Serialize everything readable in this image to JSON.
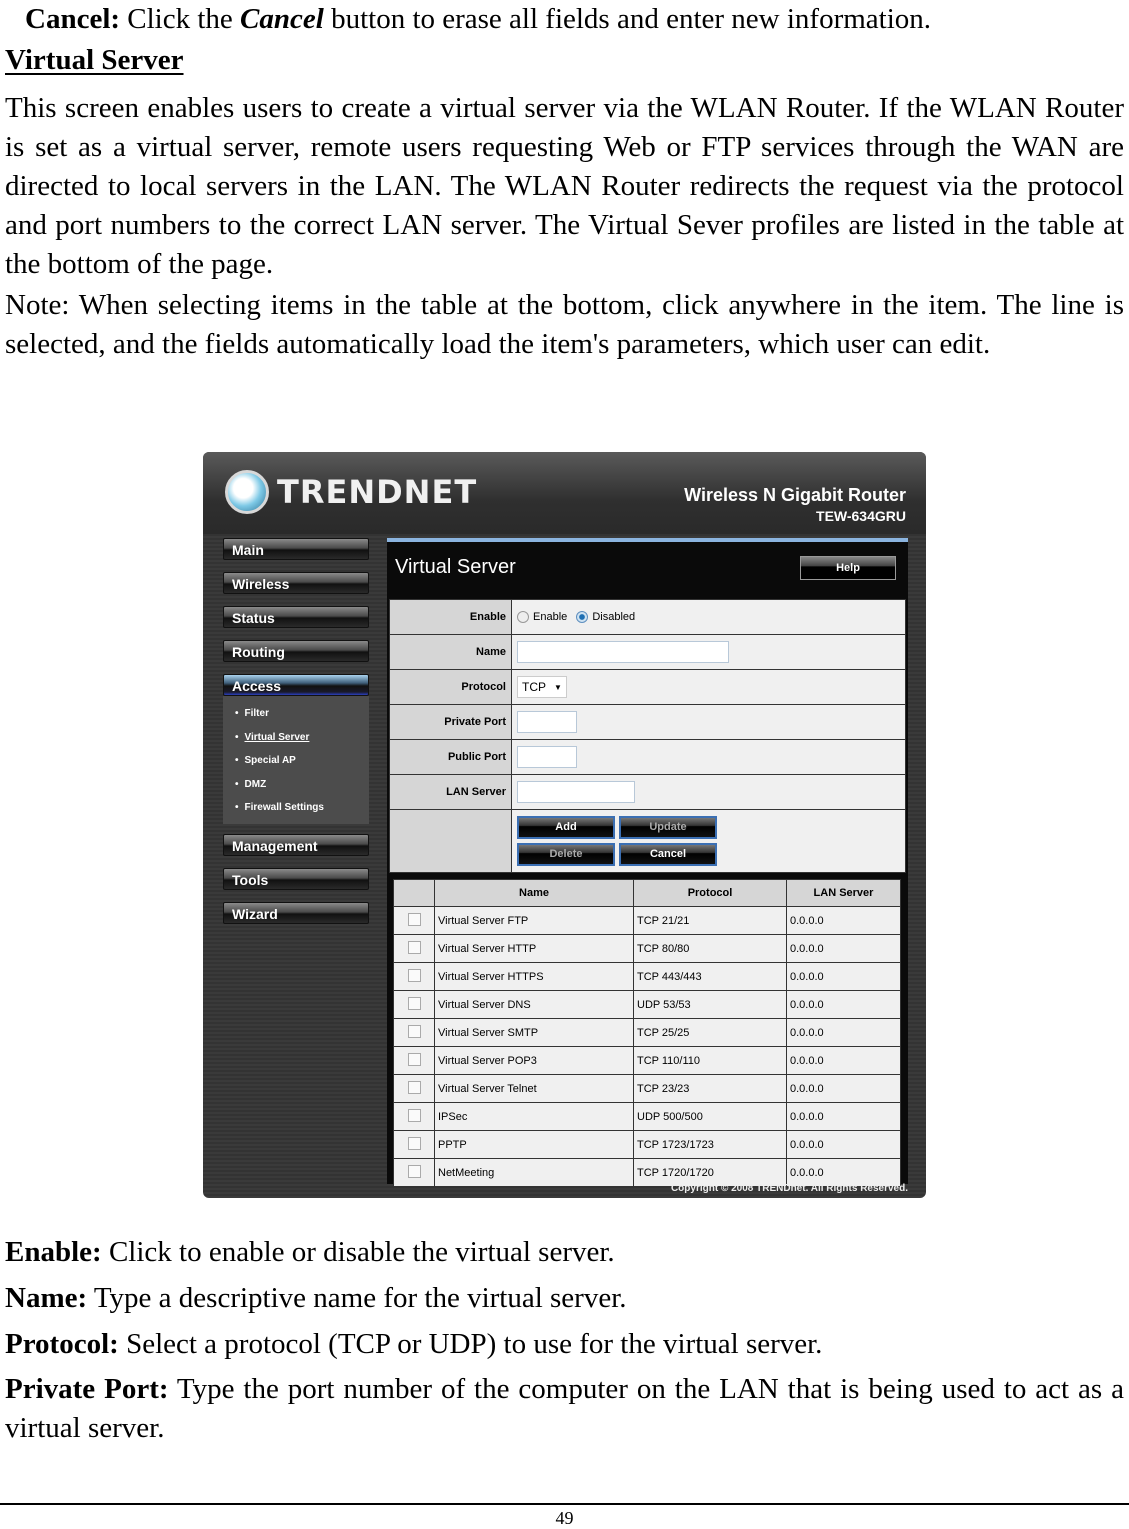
{
  "document": {
    "intro_line": {
      "label": "Cancel:",
      "pre": " Click the ",
      "em": "Cancel",
      "post": " button to erase all fields and enter new information."
    },
    "section_heading": "Virtual Server",
    "paragraph1": "This screen enables users to create a virtual server via the WLAN Router. If the WLAN Router is set as a virtual server, remote users requesting Web or FTP services through the WAN are directed to local servers in the LAN. The WLAN Router redirects the request via the protocol and port numbers to the correct LAN server. The Virtual Sever profiles are listed in the table at the bottom of the page.",
    "paragraph2": "Note: When selecting items in the table at the bottom, click anywhere in the item. The line is selected, and the fields automatically load the item's parameters, which user can edit.",
    "definitions": [
      {
        "term": "Enable:",
        "text": " Click to enable or disable the virtual server."
      },
      {
        "term": "Name:",
        "text": " Type a descriptive name for the virtual server."
      },
      {
        "term": "Protocol:",
        "text": " Select a protocol (TCP or UDP) to use for the virtual server."
      },
      {
        "term": "Private Port:",
        "text": " Type the port number of the computer on the LAN that is being used to act as a virtual server."
      }
    ],
    "page_number": "49"
  },
  "router": {
    "brand": "TRENDNET",
    "product_name": "Wireless N Gigabit Router",
    "product_model": "TEW-634GRU",
    "nav": {
      "items_top": [
        "Main",
        "Wireless",
        "Status",
        "Routing",
        "Access"
      ],
      "submenu": [
        "Filter",
        "Virtual Server",
        "Special AP",
        "DMZ",
        "Firewall Settings"
      ],
      "items_bottom": [
        "Management",
        "Tools",
        "Wizard"
      ]
    },
    "page_title": "Virtual Server",
    "help_label": "Help",
    "form": {
      "enable_label": "Enable",
      "enable_option": "Enable",
      "disabled_option": "Disabled",
      "enable_value": "Disabled",
      "name_label": "Name",
      "name_value": "",
      "protocol_label": "Protocol",
      "protocol_value": "TCP",
      "private_port_label": "Private Port",
      "private_port_value": "",
      "public_port_label": "Public Port",
      "public_port_value": "",
      "lan_server_label": "LAN Server",
      "lan_server_value": "",
      "buttons": {
        "add": "Add",
        "update": "Update",
        "delete": "Delete",
        "cancel": "Cancel"
      }
    },
    "table": {
      "columns": [
        "",
        "Name",
        "Protocol",
        "LAN Server"
      ],
      "rows": [
        {
          "name": "Virtual Server FTP",
          "protocol": "TCP 21/21",
          "lan_server": "0.0.0.0",
          "checked": false
        },
        {
          "name": "Virtual Server HTTP",
          "protocol": "TCP 80/80",
          "lan_server": "0.0.0.0",
          "checked": false
        },
        {
          "name": "Virtual Server HTTPS",
          "protocol": "TCP 443/443",
          "lan_server": "0.0.0.0",
          "checked": false
        },
        {
          "name": "Virtual Server DNS",
          "protocol": "UDP 53/53",
          "lan_server": "0.0.0.0",
          "checked": false
        },
        {
          "name": "Virtual Server SMTP",
          "protocol": "TCP 25/25",
          "lan_server": "0.0.0.0",
          "checked": false
        },
        {
          "name": "Virtual Server POP3",
          "protocol": "TCP 110/110",
          "lan_server": "0.0.0.0",
          "checked": false
        },
        {
          "name": "Virtual Server Telnet",
          "protocol": "TCP 23/23",
          "lan_server": "0.0.0.0",
          "checked": false
        },
        {
          "name": "IPSec",
          "protocol": "UDP 500/500",
          "lan_server": "0.0.0.0",
          "checked": false
        },
        {
          "name": "PPTP",
          "protocol": "TCP 1723/1723",
          "lan_server": "0.0.0.0",
          "checked": false
        },
        {
          "name": "NetMeeting",
          "protocol": "TCP 1720/1720",
          "lan_server": "0.0.0.0",
          "checked": false
        }
      ]
    },
    "copyright": "Copyright © 2008 TRENDnet. All Rights Reserved."
  }
}
